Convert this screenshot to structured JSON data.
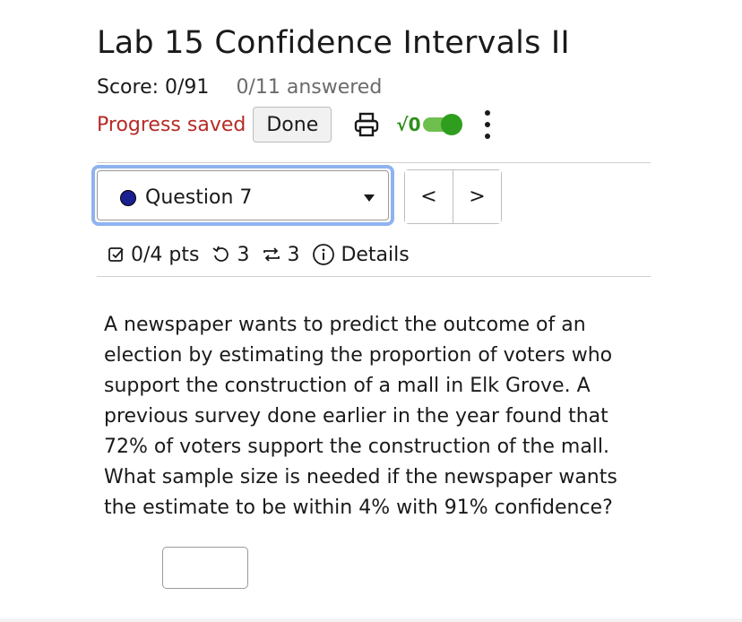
{
  "page": {
    "title": "Lab 15 Confidence Intervals II"
  },
  "score": {
    "score_text": "Score: 0/91",
    "answered_text": "0/11 answered"
  },
  "toolbar": {
    "progress_label": "Progress saved",
    "done_label": "Done",
    "sqrt_label": "√0",
    "toggle_on": true,
    "icons": [
      "print-icon",
      "sqrt-icon",
      "toggle-switch",
      "kebab-menu-icon"
    ]
  },
  "question_nav": {
    "selected_question": "Question 7",
    "prev_label": "<",
    "next_label": ">"
  },
  "meta": {
    "points": "0/4 pts",
    "attempts": "3",
    "versions": "3",
    "details_label": "Details"
  },
  "question": {
    "text": "A newspaper wants to predict the outcome of an election by estimating the proportion of voters who support the construction of a mall in Elk Grove. A previous survey done earlier in the year found that 72% of voters support the construction of the mall. What sample size is needed if the newspaper wants the estimate to be within 4% with 91% confidence?"
  },
  "answer": {
    "value": ""
  },
  "colors": {
    "progress_saved": "#b52b27",
    "focus_ring": "#8fb3f0",
    "question_dot": "#1b1f8f",
    "toggle_green": "#2f9e1f"
  }
}
